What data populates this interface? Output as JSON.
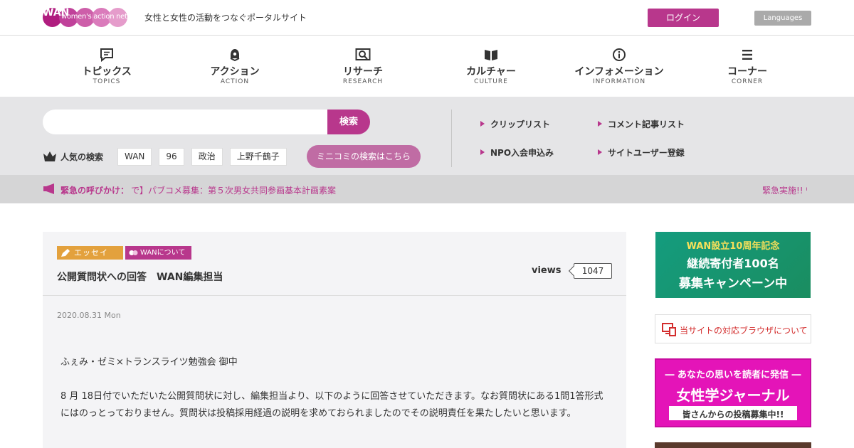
{
  "header": {
    "logo_text": "women's action network",
    "logo_mark": "WAN",
    "tagline": "女性と女性の活動をつなぐポータルサイト",
    "login_label": "ログイン",
    "languages_label": "Languages"
  },
  "nav": {
    "items": [
      {
        "label": "トピックス",
        "sub": "TOPICS",
        "icon": "chat-icon"
      },
      {
        "label": "アクション",
        "sub": "ACTION",
        "icon": "bell-icon"
      },
      {
        "label": "リサーチ",
        "sub": "RESEARCH",
        "icon": "magnifier-icon"
      },
      {
        "label": "カルチャー",
        "sub": "CULTURE",
        "icon": "book-icon"
      },
      {
        "label": "インフォメーション",
        "sub": "INFORMATION",
        "icon": "info-icon"
      },
      {
        "label": "コーナー",
        "sub": "CORNER",
        "icon": "menu-icon"
      }
    ]
  },
  "search": {
    "placeholder": "",
    "button_label": "検索",
    "popular_label": "人気の検索",
    "tags": [
      "WAN",
      "96",
      "政治",
      "上野千鶴子"
    ],
    "minikomi_label": "ミニコミの検索はこちら"
  },
  "quick_links": [
    "クリップリスト",
    "コメント記事リスト",
    "NPO入会申込み",
    "サイトユーザー登録"
  ],
  "urgent": {
    "label": "緊急の呼びかけ：",
    "text": "で】パブコメ募集：第５次男女共同参画基本計画素案",
    "right_text": "緊急実施!! ᴵ"
  },
  "article": {
    "category_essay": "エッセイ",
    "category_wan": "WANについて",
    "title": "公開質問状への回答　WAN編集担当",
    "views_label": "views",
    "views_count": "1047",
    "date": "2020.08.31 Mon",
    "paragraphs": [
      "ふぇみ・ゼミ×トランスライツ勉強会 御中",
      "8 月 18日付でいただいた公開質問状に対し、編集担当より、以下のように回答させていただきます。なお質問状にある1問1答形式にはのっとっておりません。質問状は投稿採用経過の説明を求めておられましたのでその説明責任を果たしたいと思います。"
    ]
  },
  "sidebar": {
    "anniv_line1": "WAN設立10周年記念",
    "anniv_line2": "継続寄付者100名",
    "anniv_line3": "募集キャンペーン中",
    "browser_text": "当サイトの対応ブラウザについて",
    "journal_line1": "― あなたの思いを読者に発信 ―",
    "journal_line2": "女性学ジャーナル",
    "journal_line3": "皆さんからの投稿募集中!!"
  },
  "colors": {
    "brand": "#b8378c",
    "urgent_bg": "#d5d5d6",
    "search_bg": "#e5e5e7",
    "essay_badge": "#e3a13d",
    "journal_banner": "#e414b8",
    "anniv_banner": "#149c7e"
  }
}
